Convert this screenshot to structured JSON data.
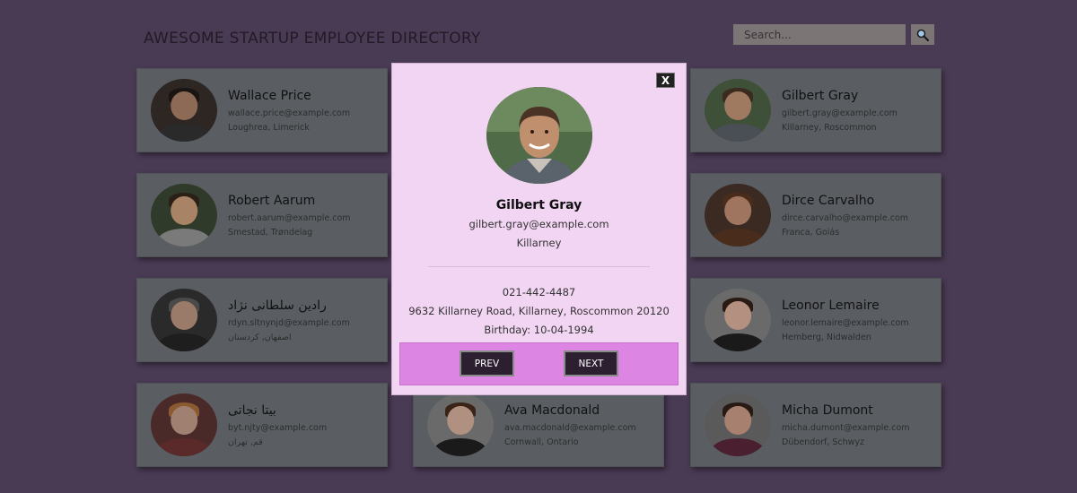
{
  "header": {
    "title": "AWESOME STARTUP EMPLOYEE DIRECTORY"
  },
  "search": {
    "placeholder": "Search...",
    "button_icon": "magnifier-icon"
  },
  "employees": [
    {
      "name": "Wallace Price",
      "email": "wallace.price@example.com",
      "location": "Loughrea, Limerick",
      "avatar_bg": "#2d2623",
      "skin": "#8c6a55",
      "hair": "#1a1512",
      "shirt": "#2a2a2a"
    },
    {
      "name": "Gilbert Gray",
      "email": "gilbert.gray@example.com",
      "location": "Killarney, Roscommon",
      "avatar_bg": "#3e5138",
      "skin": "#a07a60",
      "hair": "#3a2a20",
      "shirt": "#4a4e55"
    },
    {
      "name": "Robert Aarum",
      "email": "robert.aarum@example.com",
      "location": "Smestad, Trøndelag",
      "avatar_bg": "#2f3a2b",
      "skin": "#a98366",
      "hair": "#2b2018",
      "shirt": "#7a7a7a"
    },
    {
      "name": "Dirce Carvalho",
      "email": "dirce.carvalho@example.com",
      "location": "Franca, Goiás",
      "avatar_bg": "#3a2a22",
      "skin": "#a07560",
      "hair": "#4a2c1c",
      "shirt": "#4a2c1c"
    },
    {
      "name": "رادین سلطانی نژاد",
      "email": "rdyn.sltnynjd@example.com",
      "location": "اصفهان, کردستان",
      "avatar_bg": "#2a2a2a",
      "skin": "#9a7a68",
      "hair": "#4a4a4a",
      "shirt": "#1e1e1e"
    },
    {
      "name": "Leonor Lemaire",
      "email": "leonor.lemaire@example.com",
      "location": "Hemberg, Nidwalden",
      "avatar_bg": "#6a6a6a",
      "skin": "#b49080",
      "hair": "#2a1a14",
      "shirt": "#1a1a1a"
    },
    {
      "name": "بیتا نجاتی",
      "email": "byt.njty@example.com",
      "location": "قم, تهران",
      "avatar_bg": "#4a2a28",
      "skin": "#a08070",
      "hair": "#8a5a30",
      "shirt": "#5a2a2a"
    },
    {
      "name": "Ava Macdonald",
      "email": "ava.macdonald@example.com",
      "location": "Cornwall, Ontario",
      "avatar_bg": "#6a6a6a",
      "skin": "#b09080",
      "hair": "#3a2418",
      "shirt": "#1a1a1a"
    },
    {
      "name": "Micha Dumont",
      "email": "micha.dumont@example.com",
      "location": "Dübendorf, Schwyz",
      "avatar_bg": "#5a5a5a",
      "skin": "#a88070",
      "hair": "#2a1a14",
      "shirt": "#4a2030"
    }
  ],
  "modal": {
    "close_label": "X",
    "name": "Gilbert Gray",
    "email": "gilbert.gray@example.com",
    "city": "Killarney",
    "phone": "021-442-4487",
    "address": "9632 Killarney Road, Killarney, Roscommon 20120",
    "birthday": "Birthday: 10-04-1994",
    "prev_label": "PREV",
    "next_label": "NEXT"
  }
}
